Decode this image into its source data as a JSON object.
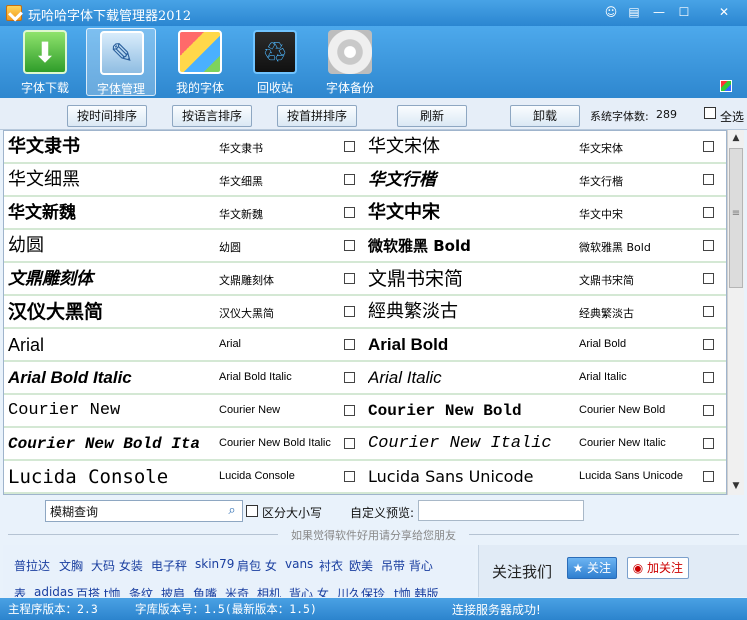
{
  "window": {
    "title": "玩哈哈字体下载管理器2012",
    "controls": [
      "chat-icon",
      "skin-icon",
      "minimize-icon",
      "maximize-icon",
      "close-icon"
    ]
  },
  "toolbar": {
    "items": [
      {
        "label": "字体下载",
        "icon": "download-icon",
        "active": false
      },
      {
        "label": "字体管理",
        "icon": "manage-icon",
        "active": true
      },
      {
        "label": "我的字体",
        "icon": "my-fonts-icon",
        "active": false
      },
      {
        "label": "回收站",
        "icon": "recycle-bin-icon",
        "active": false
      },
      {
        "label": "字体备份",
        "icon": "backup-disc-icon",
        "active": false
      }
    ]
  },
  "sortbar": {
    "buttons": [
      "按时间排序",
      "按语言排序",
      "按首拼排序",
      "刷新",
      "卸载"
    ],
    "system_count_label": "系统字体数:",
    "system_count": "289",
    "select_all_label": "全选"
  },
  "fonts": [
    {
      "left_preview": "华文隶书",
      "left_name": "华文隶书",
      "right_preview": "华文宋体",
      "right_name": "华文宋体"
    },
    {
      "left_preview": "华文细黑",
      "left_name": "华文细黑",
      "right_preview": "华文行楷",
      "right_name": "华文行楷"
    },
    {
      "left_preview": "华文新魏",
      "left_name": "华文新魏",
      "right_preview": "华文中宋",
      "right_name": "华文中宋"
    },
    {
      "left_preview": "幼圆",
      "left_name": "幼圆",
      "right_preview": "微软雅黑 Bold",
      "right_name": "微软雅黑 Bold"
    },
    {
      "left_preview": "文鼎雕刻体",
      "left_name": "文鼎雕刻体",
      "right_preview": "文鼎书宋简",
      "right_name": "文鼎书宋简"
    },
    {
      "left_preview": "汉仪大黑简",
      "left_name": "汉仪大黑简",
      "right_preview": "經典繁淡古",
      "right_name": "经典繁淡古"
    },
    {
      "left_preview": "Arial",
      "left_name": "Arial",
      "right_preview": "Arial Bold",
      "right_name": "Arial Bold"
    },
    {
      "left_preview": "Arial Bold Italic",
      "left_name": "Arial Bold Italic",
      "right_preview": "Arial Italic",
      "right_name": "Arial Italic"
    },
    {
      "left_preview": "Courier New",
      "left_name": "Courier New",
      "right_preview": "Courier New Bold",
      "right_name": "Courier New Bold"
    },
    {
      "left_preview": "Courier New Bold Ita",
      "left_name": "Courier New Bold Italic",
      "right_preview": "Courier New Italic",
      "right_name": "Courier New Italic"
    },
    {
      "left_preview": "Lucida Console",
      "left_name": "Lucida Console",
      "right_preview": "Lucida Sans Unicode",
      "right_name": "Lucida Sans Unicode"
    }
  ],
  "search": {
    "value": "模糊查询",
    "case_label": "区分大小写",
    "preview_label": "自定义预览:",
    "preview_value": ""
  },
  "share_hint": "如果觉得软件好用请分享给您朋友",
  "tags": {
    "row1": [
      "普拉达",
      "文胸",
      "大码 女装",
      "电子秤",
      "skin79",
      "肩包 女",
      "vans",
      "衬衣",
      "欧美",
      "吊带 背心"
    ],
    "row2": [
      "表",
      "adidas",
      "百搭 t恤",
      "条纹",
      "披肩",
      "鱼嘴",
      "米奇",
      "相机",
      "背心 女",
      "川久保玲",
      "t恤 韩版"
    ]
  },
  "follow": {
    "title": "关注我们",
    "qq_label": "关注",
    "weibo_label": "加关注"
  },
  "status": {
    "program_version": "主程序版本：2.3",
    "library_version": "字库版本号：1.5(最新版本：1.5)",
    "connection": "连接服务器成功!"
  }
}
